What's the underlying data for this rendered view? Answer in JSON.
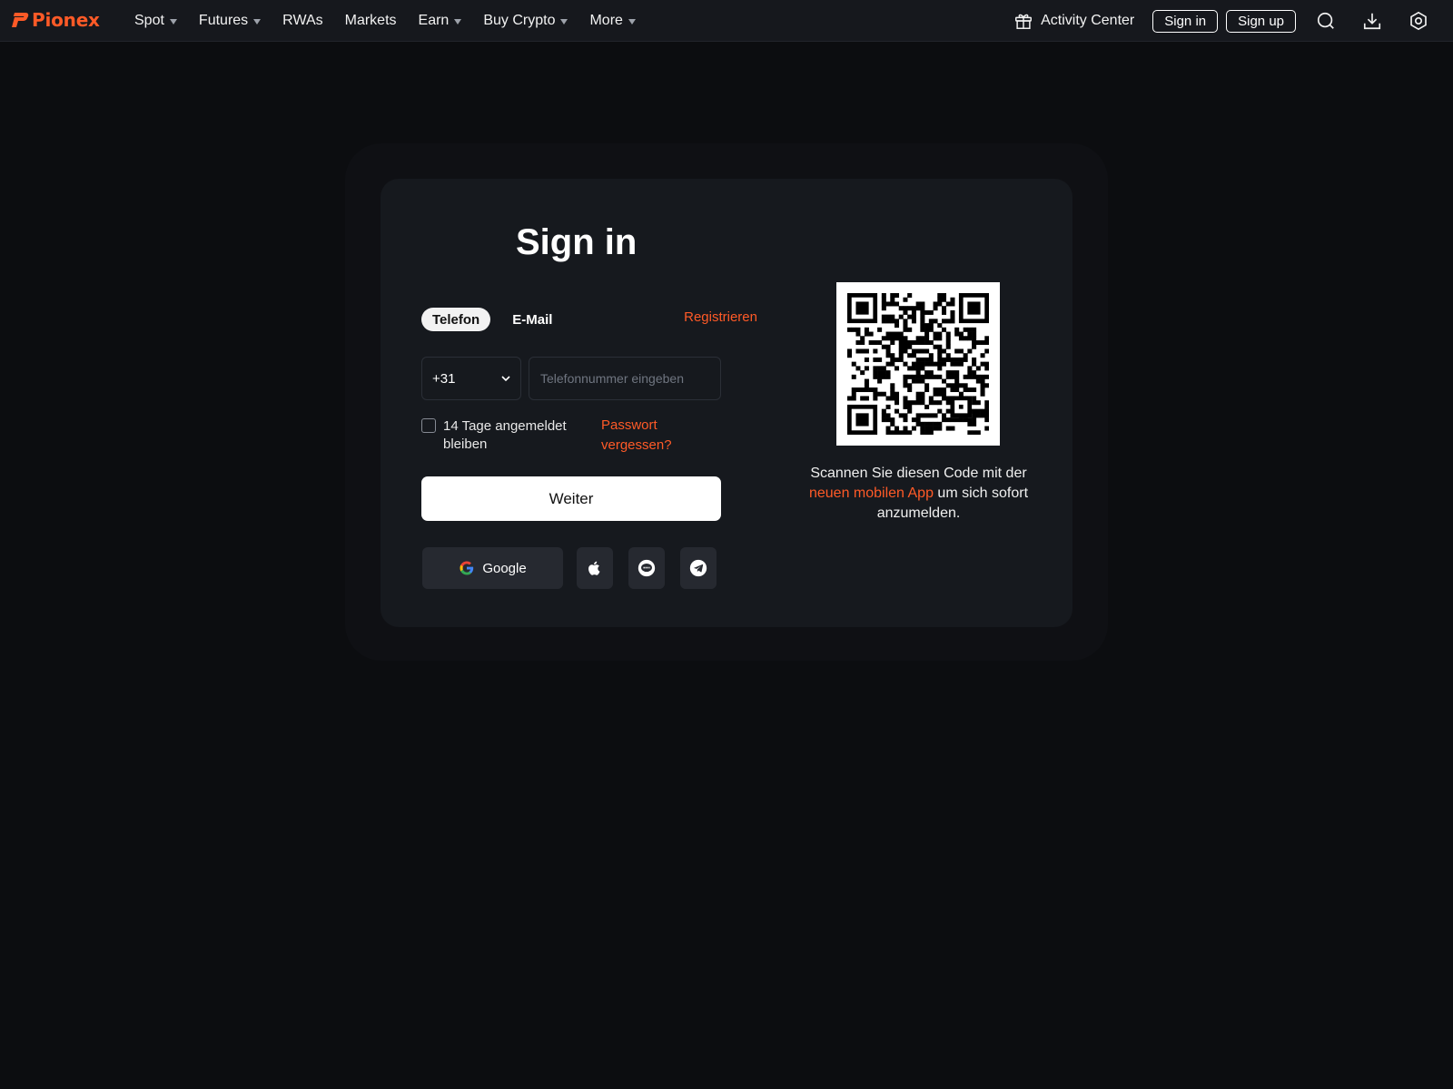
{
  "header": {
    "logo_text": "Pionex",
    "nav": [
      {
        "label": "Spot",
        "dropdown": true
      },
      {
        "label": "Futures",
        "dropdown": true
      },
      {
        "label": "RWAs",
        "dropdown": false
      },
      {
        "label": "Markets",
        "dropdown": false
      },
      {
        "label": "Earn",
        "dropdown": true
      },
      {
        "label": "Buy Crypto",
        "dropdown": true
      },
      {
        "label": "More",
        "dropdown": true
      }
    ],
    "activity_center": "Activity Center",
    "sign_in": "Sign in",
    "sign_up": "Sign up",
    "icons": [
      "gift-icon",
      "search-icon",
      "download-icon",
      "settings-icon"
    ]
  },
  "login": {
    "title": "Sign in",
    "tabs": [
      {
        "label": "Telefon",
        "active": true
      },
      {
        "label": "E-Mail",
        "active": false
      }
    ],
    "register_link": "Registrieren",
    "country_code": "+31",
    "phone_placeholder": "Telefonnummer eingeben",
    "remember_label": "14 Tage angemeldet bleiben",
    "remember_checked": false,
    "forgot_password": "Passwort vergessen?",
    "submit_label": "Weiter",
    "social": {
      "google_label": "Google",
      "icons": [
        "apple-icon",
        "line-icon",
        "telegram-icon"
      ]
    }
  },
  "qr": {
    "text_before": "Scannen Sie diesen Code mit der",
    "text_link": "neuen mobilen App",
    "text_after": "um sich sofort anzumelden."
  },
  "colors": {
    "accent": "#ff5a27",
    "background": "#0c0d10",
    "topbar": "#16181d",
    "card": "#16191e"
  }
}
